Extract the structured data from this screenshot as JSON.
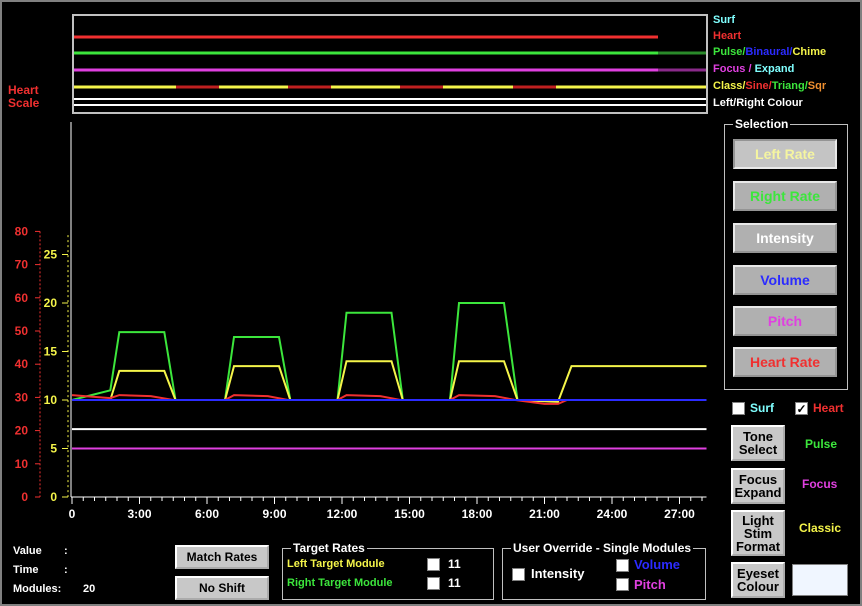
{
  "legend": {
    "surf": "Surf",
    "heart": "Heart",
    "pulse_row": [
      "Pulse/",
      "Binaural/",
      "Chime"
    ],
    "focus_row": [
      "Focus",
      " / ",
      "Expand"
    ],
    "class_row": [
      "Class/",
      "Sine/",
      "Triang/",
      "Sqr"
    ],
    "lr_colour": "Left/Right Colour"
  },
  "heart_scale": {
    "title_1": "Heart",
    "title_2": "Scale",
    "ticks": [
      "80",
      "70",
      "60",
      "50",
      "40",
      "30",
      "20",
      "10",
      "0"
    ]
  },
  "inner_ticks": [
    "25",
    "20",
    "15",
    "10",
    "5",
    "0"
  ],
  "x_ticks": [
    "0",
    "3:00",
    "6:00",
    "9:00",
    "12:00",
    "15:00",
    "18:00",
    "21:00",
    "24:00",
    "27:00"
  ],
  "selection": {
    "title": "Selection",
    "buttons": [
      "Left Rate",
      "Right Rate",
      "Intensity",
      "Volume",
      "Pitch",
      "Heart Rate"
    ]
  },
  "toggles": {
    "surf": "Surf",
    "heart": "Heart",
    "heart_checked": "✓"
  },
  "right_buttons": {
    "tone_select": [
      "Tone",
      "Select"
    ],
    "tone_label": "Pulse",
    "focus_expand": [
      "Focus",
      "Expand"
    ],
    "focus_label": "Focus",
    "light_stim": [
      "Light",
      "Stim",
      "Format"
    ],
    "light_label": "Classic",
    "eyeset": [
      "Eyeset",
      "Colour"
    ]
  },
  "info": {
    "value_label": "Value",
    "time_label": "Time",
    "modules_label": "Modules:",
    "colon": ":",
    "modules_value": "20"
  },
  "bottom_buttons": {
    "match": "Match Rates",
    "shift": "No Shift"
  },
  "target_rates": {
    "title": "Target Rates",
    "left": "Left Target Module",
    "right": "Right Target Module",
    "left_value": "11",
    "right_value": "11"
  },
  "override": {
    "title": "User Override - Single Modules",
    "intensity": "Intensity",
    "volume": "Volume",
    "pitch": "Pitch"
  },
  "colors": {
    "green": "#3ce63c",
    "yellow": "#f5f54a",
    "red": "#f03030",
    "blue": "#2b2bff",
    "magenta": "#e040e0",
    "cyan": "#80ffff",
    "white": "#ffffff"
  },
  "chart_data": {
    "type": "line",
    "x_unit": "minutes",
    "x_ticks": [
      "0",
      "3:00",
      "6:00",
      "9:00",
      "12:00",
      "15:00",
      "18:00",
      "21:00",
      "24:00",
      "27:00"
    ],
    "inner_scale_ylim": [
      0,
      27
    ],
    "heart_scale_ylim": [
      0,
      80
    ],
    "series": [
      {
        "color": "green",
        "points": [
          [
            0,
            10
          ],
          [
            1.7,
            11
          ],
          [
            2.1,
            17
          ],
          [
            4.1,
            17
          ],
          [
            4.6,
            10
          ],
          [
            6.8,
            10
          ],
          [
            7.2,
            16.5
          ],
          [
            9.2,
            16.5
          ],
          [
            9.7,
            10
          ],
          [
            11.8,
            10
          ],
          [
            12.2,
            19
          ],
          [
            14.2,
            19
          ],
          [
            14.7,
            10
          ],
          [
            16.8,
            10
          ],
          [
            17.2,
            20
          ],
          [
            19.2,
            20
          ],
          [
            19.8,
            10
          ],
          [
            22,
            10
          ],
          [
            28.2,
            10
          ]
        ]
      },
      {
        "color": "yellow",
        "points": [
          [
            0,
            10
          ],
          [
            1.7,
            10
          ],
          [
            2.1,
            13
          ],
          [
            4.1,
            13
          ],
          [
            4.6,
            10
          ],
          [
            6.8,
            10
          ],
          [
            7.2,
            13.5
          ],
          [
            9.2,
            13.5
          ],
          [
            9.7,
            10
          ],
          [
            11.8,
            10
          ],
          [
            12.2,
            14
          ],
          [
            14.2,
            14
          ],
          [
            14.7,
            10
          ],
          [
            16.8,
            10
          ],
          [
            17.2,
            14
          ],
          [
            19.2,
            14
          ],
          [
            19.8,
            10
          ],
          [
            21.6,
            9.8
          ],
          [
            22.2,
            13.5
          ],
          [
            28.2,
            13.5
          ]
        ]
      },
      {
        "color": "red",
        "points": [
          [
            0,
            10.5
          ],
          [
            1.7,
            10.2
          ],
          [
            2.1,
            10.5
          ],
          [
            3.5,
            10.4
          ],
          [
            4.5,
            10
          ],
          [
            6.8,
            10
          ],
          [
            7.2,
            10.5
          ],
          [
            8.7,
            10.4
          ],
          [
            9.6,
            10
          ],
          [
            11.8,
            10
          ],
          [
            12.2,
            10.5
          ],
          [
            13.7,
            10.4
          ],
          [
            14.6,
            10
          ],
          [
            16.8,
            10
          ],
          [
            17.2,
            10.5
          ],
          [
            18.8,
            10.4
          ],
          [
            19.7,
            10
          ],
          [
            21,
            9.6
          ],
          [
            21.6,
            9.6
          ],
          [
            22,
            10
          ],
          [
            28.2,
            10
          ]
        ]
      },
      {
        "color": "blue",
        "points": [
          [
            0,
            10
          ],
          [
            28.2,
            10
          ]
        ]
      },
      {
        "color": "white",
        "points": [
          [
            0,
            7
          ],
          [
            28.2,
            7
          ]
        ]
      },
      {
        "color": "magenta",
        "points": [
          [
            0,
            5
          ],
          [
            28.2,
            5
          ]
        ]
      }
    ]
  }
}
